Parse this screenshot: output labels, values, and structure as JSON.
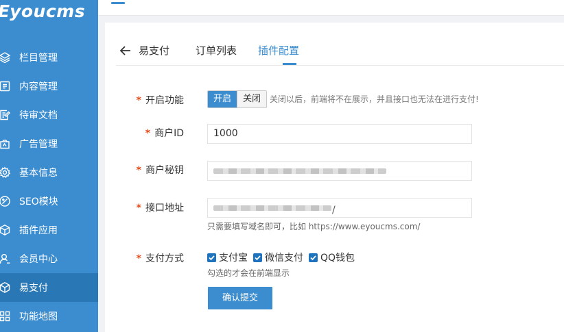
{
  "brand": {
    "logo_text": "youcms",
    "logo_mark": "E"
  },
  "sidebar": {
    "items": [
      {
        "label": "栏目管理",
        "icon": "layers-icon"
      },
      {
        "label": "内容管理",
        "icon": "document-list-icon"
      },
      {
        "label": "待审文档",
        "icon": "edit-document-icon"
      },
      {
        "label": "广告管理",
        "icon": "ad-bag-icon"
      },
      {
        "label": "基本信息",
        "icon": "gear-icon"
      },
      {
        "label": "SEO模块",
        "icon": "tag-icon"
      },
      {
        "label": "插件应用",
        "icon": "cube-icon"
      },
      {
        "label": "会员中心",
        "icon": "user-icon"
      },
      {
        "label": "易支付",
        "icon": "cube-icon",
        "active": true
      },
      {
        "label": "功能地图",
        "icon": "grid-icon"
      }
    ]
  },
  "tabs": {
    "back_label": "易支付",
    "order_list": "订单列表",
    "plugin_config": "插件配置"
  },
  "form": {
    "enable_label": "开启功能",
    "enable_on": "开启",
    "enable_off": "关闭",
    "enable_hint": "关闭以后，前端将不在展示，并且接口也无法在进行支付!",
    "merchant_id_label": "商户ID",
    "merchant_id_value": "1000",
    "merchant_secret_label": "商户秘钥",
    "api_url_label": "接口地址",
    "api_url_suffix": "/",
    "api_url_help": "只需要填写域名即可，比如 https://www.eyoucms.com/",
    "pay_method_label": "支付方式",
    "pay_methods": [
      "支付宝",
      "微信支付",
      "QQ钱包"
    ],
    "pay_method_help": "勾选的才会在前端显示",
    "submit_label": "确认提交",
    "required_mark": "*"
  },
  "colors": {
    "primary": "#3c8dd0",
    "sidebar_active": "#2a77b6",
    "required": "#e64a19"
  }
}
